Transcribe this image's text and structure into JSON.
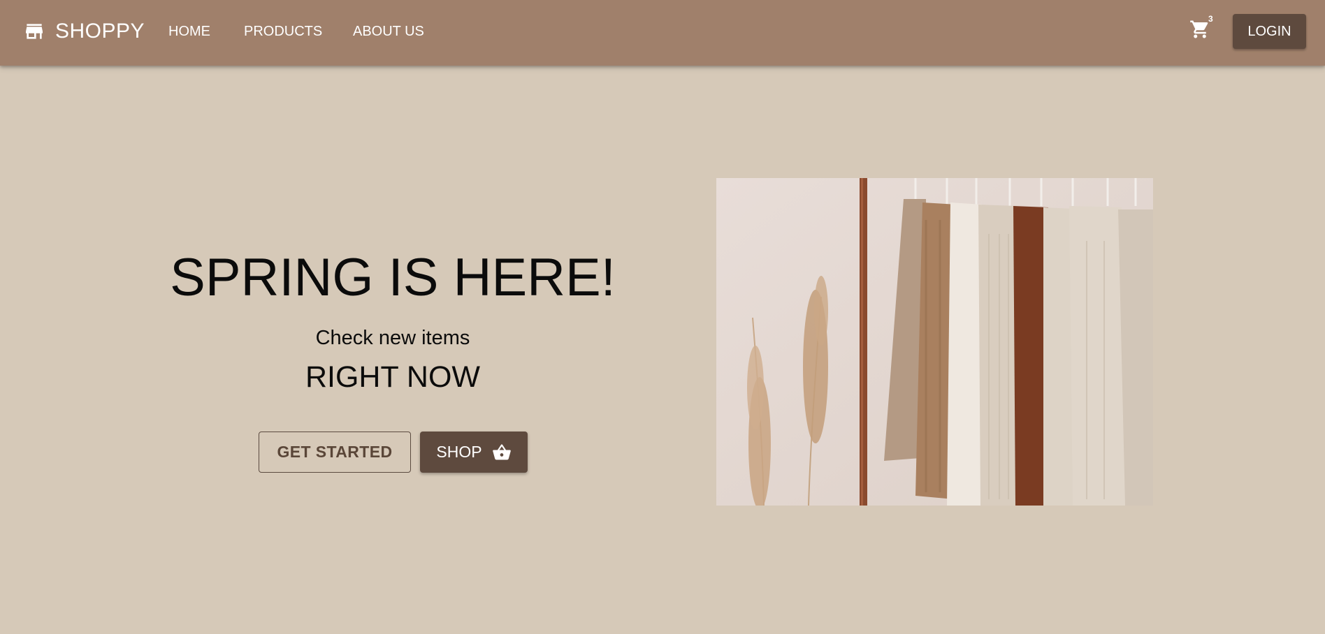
{
  "header": {
    "brand": "SHOPPY",
    "brand_icon": "storefront-icon",
    "nav": [
      "HOME",
      "PRODUCTS",
      "ABOUT US"
    ],
    "cart_icon": "cart-icon",
    "cart_count": "3",
    "login_label": "LOGIN",
    "bar_color": "#a0806b"
  },
  "hero": {
    "title": "SPRING IS HERE!",
    "subtitle": "Check new items",
    "tagline": "RIGHT NOW",
    "get_started_label": "GET STARTED",
    "shop_label": "SHOP",
    "shop_icon": "shopping-basket-icon",
    "image_icon": "clothes-rack-photo",
    "button_color": "#5e4a3e",
    "background_color": "#d6c9b8"
  }
}
